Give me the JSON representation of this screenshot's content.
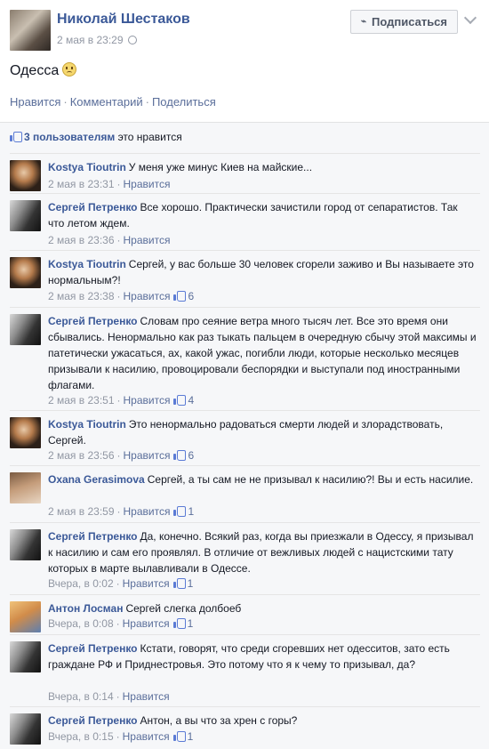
{
  "post": {
    "author": "Николай Шестаков",
    "time": "2 мая в 23:29",
    "privacy_icon": "globe-icon",
    "subscribe_label": "Подписаться",
    "text": "Одесса",
    "emoji": "sad-face",
    "actions": {
      "like": "Нравится",
      "comment": "Комментарий",
      "share": "Поделиться"
    }
  },
  "likes": {
    "count_text": "3 пользователям",
    "suffix": " это нравится"
  },
  "comments": [
    {
      "author": "Kostya Tioutrin",
      "text": "У меня уже минус Киев на майские...",
      "time": "2 мая в 23:31",
      "like": "Нравится",
      "likes": ""
    },
    {
      "author": "Сергей Петренко",
      "text": "Все хорошо. Практически зачистили город от сепаратистов. Так что летом ждем.",
      "time": "2 мая в 23:36",
      "like": "Нравится",
      "likes": ""
    },
    {
      "author": "Kostya Tioutrin",
      "text": "Сергей, у вас больше 30 человек сгорели заживо и Вы называете это нормальным?!",
      "time": "2 мая в 23:38",
      "like": "Нравится",
      "likes": "6"
    },
    {
      "author": "Сергей Петренко",
      "text": "Словам про сеяние ветра много тысяч лет. Все это время они сбывались. Ненормально как раз тыкать пальцем в очередную сбычу этой максимы и патетически ужасаться, ах, какой ужас, погибли люди, которые несколько месяцев призывали к насилию, провоцировали беспорядки и выступали под иностранными флагами.",
      "time": "2 мая в 23:51",
      "like": "Нравится",
      "likes": "4"
    },
    {
      "author": "Kostya Tioutrin",
      "text": "Это ненормально радоваться смерти людей и злорадствовать, Сергей.",
      "time": "2 мая в 23:56",
      "like": "Нравится",
      "likes": "6"
    },
    {
      "author": "Oxana Gerasimova",
      "text": "Сергей, а ты сам не не призывал к насилию?! Вы и есть насилие.",
      "time": "2 мая в 23:59",
      "like": "Нравится",
      "likes": "1"
    },
    {
      "author": "Сергей Петренко",
      "text": "Да, конечно. Всякий раз, когда вы приезжали в Одессу, я призывал к насилию и сам его проявлял. В отличие от вежливых людей с нацистскими тату которых в марте вылавливали в Одессе.",
      "time": "Вчера, в 0:02",
      "like": "Нравится",
      "likes": "1"
    },
    {
      "author": "Антон Лосман",
      "text": "Сергей слегка долбоеб",
      "time": "Вчера, в 0:08",
      "like": "Нравится",
      "likes": "1"
    },
    {
      "author": "Сергей Петренко",
      "text": "Кстати, говорят, что среди сгоревших нет одесситов, зато есть граждане РФ и Приднестровья. Это потому что я к чему то призывал, да?",
      "time": "Вчера, в 0:14",
      "like": "Нравится",
      "likes": ""
    },
    {
      "author": "Сергей Петренко",
      "text": "Антон, а вы что за хрен с горы?",
      "time": "Вчера, в 0:15",
      "like": "Нравится",
      "likes": "1"
    }
  ]
}
